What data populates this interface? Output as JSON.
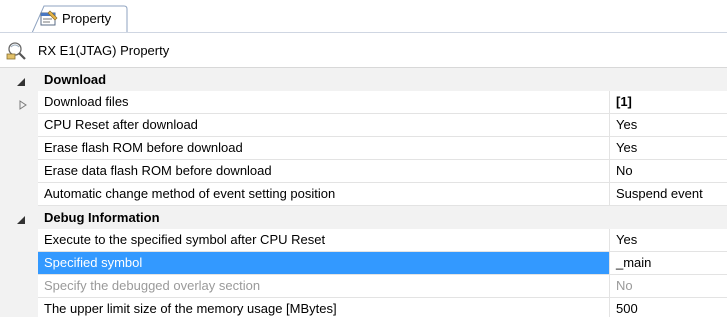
{
  "tab": {
    "label": "Property",
    "icon": "property-sheet-icon"
  },
  "header": {
    "title": "RX E1(JTAG) Property",
    "icon": "debug-tool-icon"
  },
  "colors": {
    "selection": "#3399ff",
    "gutter": "#f2f2f2",
    "disabled_text": "#9a9a9a"
  },
  "categories": [
    {
      "label": "Download",
      "expanded": true,
      "rows": [
        {
          "name": "Download files",
          "value": "[1]",
          "bold_value": true,
          "expandable": true
        },
        {
          "name": "CPU Reset after download",
          "value": "Yes"
        },
        {
          "name": "Erase flash ROM before download",
          "value": "Yes"
        },
        {
          "name": "Erase data flash ROM before download",
          "value": "No"
        },
        {
          "name": "Automatic change method of event setting position",
          "value": "Suspend event"
        }
      ]
    },
    {
      "label": "Debug Information",
      "expanded": true,
      "rows": [
        {
          "name": "Execute to the specified symbol after CPU Reset",
          "value": "Yes"
        },
        {
          "name": "Specified symbol",
          "value": "_main",
          "selected": true
        },
        {
          "name": "Specify the debugged overlay section",
          "value": "No",
          "disabled": true
        },
        {
          "name": "The upper limit size of the memory usage [MBytes]",
          "value": "500"
        }
      ]
    }
  ]
}
